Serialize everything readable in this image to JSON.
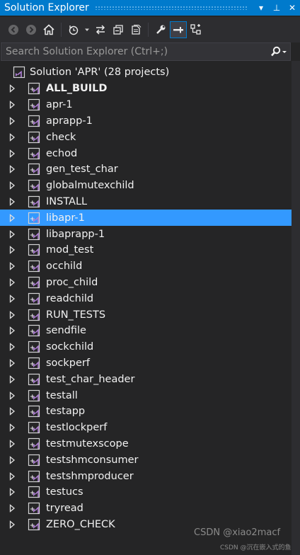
{
  "window": {
    "title": "Solution Explorer",
    "controls": [
      "▾",
      "⊥",
      "✕"
    ]
  },
  "toolbar": {
    "icons": [
      "back-icon",
      "forward-icon",
      "home-icon",
      "history-icon",
      "sync-icon",
      "collapse-all-icon",
      "show-all-files-icon",
      "properties-icon",
      "preview-icon",
      "class-view-icon"
    ]
  },
  "search": {
    "placeholder": "Search Solution Explorer (Ctrl+;)"
  },
  "solution": {
    "label": "Solution 'APR' (28 projects)"
  },
  "projects": [
    {
      "label": "ALL_BUILD",
      "bold": true
    },
    {
      "label": "apr-1"
    },
    {
      "label": "aprapp-1"
    },
    {
      "label": "check"
    },
    {
      "label": "echod"
    },
    {
      "label": "gen_test_char"
    },
    {
      "label": "globalmutexchild"
    },
    {
      "label": "INSTALL"
    },
    {
      "label": "libapr-1",
      "selected": true
    },
    {
      "label": "libaprapp-1"
    },
    {
      "label": "mod_test"
    },
    {
      "label": "occhild"
    },
    {
      "label": "proc_child"
    },
    {
      "label": "readchild"
    },
    {
      "label": "RUN_TESTS"
    },
    {
      "label": "sendfile"
    },
    {
      "label": "sockchild"
    },
    {
      "label": "sockperf"
    },
    {
      "label": "test_char_header"
    },
    {
      "label": "testall"
    },
    {
      "label": "testapp"
    },
    {
      "label": "testlockperf"
    },
    {
      "label": "testmutexscope"
    },
    {
      "label": "testshmconsumer"
    },
    {
      "label": "testshmproducer"
    },
    {
      "label": "testucs"
    },
    {
      "label": "tryread"
    },
    {
      "label": "ZERO_CHECK"
    }
  ],
  "watermark": {
    "line1": "CSDN @xiao2macf",
    "line2": "CSDN @沉在嵌入式的鱼"
  },
  "colors": {
    "title_bar": "#007acc",
    "selection": "#3399ff",
    "background": "#252526"
  }
}
